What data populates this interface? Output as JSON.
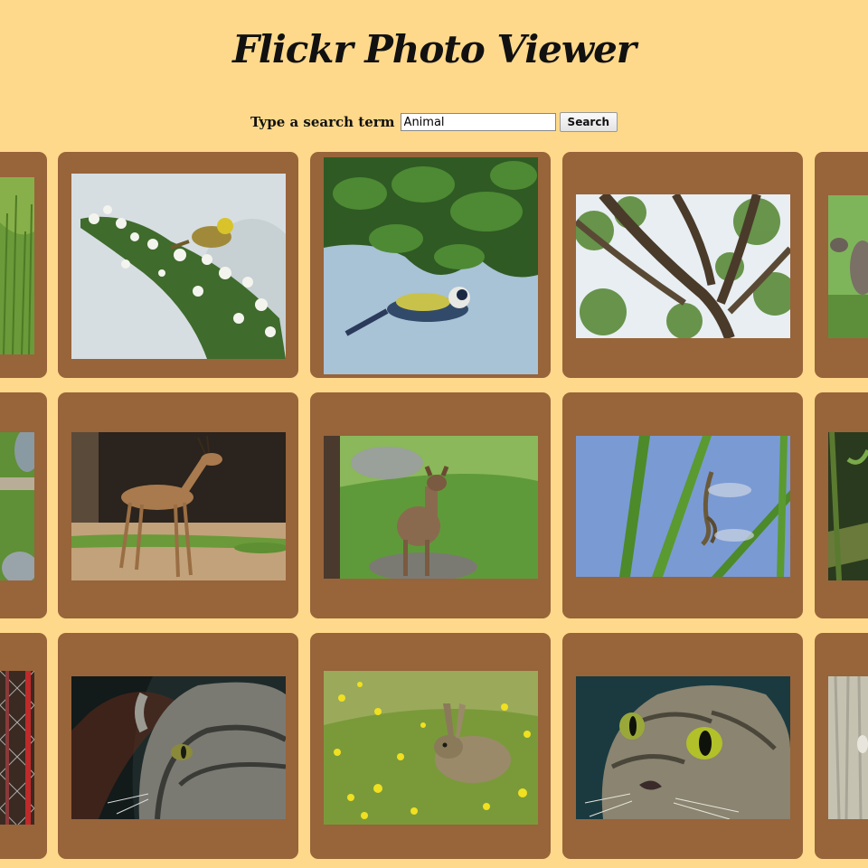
{
  "header": {
    "title": "Flickr Photo Viewer"
  },
  "search": {
    "label": "Type a search term",
    "value": "Animal",
    "button_label": "Search"
  },
  "colors": {
    "background": "#ffd98b",
    "card": "#98643a"
  },
  "photos": [
    {
      "subject": "grass-photo"
    },
    {
      "subject": "yellowhammer-on-hawthorn-photo"
    },
    {
      "subject": "blue-tit-hanging-photo"
    },
    {
      "subject": "tree-branches-photo"
    },
    {
      "subject": "capybara-field-photo"
    },
    {
      "subject": "rocks-grass-photo"
    },
    {
      "subject": "gerenuk-antelope-photo"
    },
    {
      "subject": "deer-in-grass-photo"
    },
    {
      "subject": "dragonflies-on-reeds-photo"
    },
    {
      "subject": "mossy-log-photo"
    },
    {
      "subject": "fence-photo"
    },
    {
      "subject": "tabby-cat-profile-photo"
    },
    {
      "subject": "rabbit-in-flowers-photo"
    },
    {
      "subject": "tabby-cat-face-photo"
    },
    {
      "subject": "pale-bark-photo"
    }
  ]
}
